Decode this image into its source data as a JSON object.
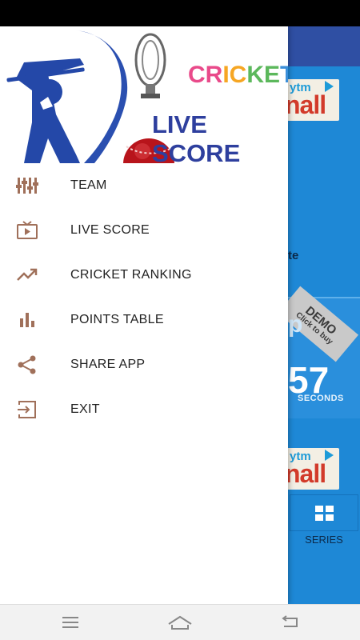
{
  "header": {
    "title_line1_parts": [
      "CR",
      "IC",
      "KE",
      "T"
    ],
    "title_line2": "LIVE SCORE"
  },
  "menu": {
    "items": [
      {
        "label": "TEAM",
        "icon": "equalizer-icon"
      },
      {
        "label": "LIVE SCORE",
        "icon": "tv-play-icon"
      },
      {
        "label": "CRICKET RANKING",
        "icon": "trending-up-icon"
      },
      {
        "label": "POINTS TABLE",
        "icon": "bar-chart-icon"
      },
      {
        "label": "SHARE APP",
        "icon": "share-icon"
      },
      {
        "label": "EXIT",
        "icon": "exit-icon"
      }
    ]
  },
  "background": {
    "ad_top": {
      "prefix": "ytm",
      "brand": "nall"
    },
    "ad_bottom": {
      "prefix": "ytm",
      "brand": "nall"
    },
    "partial_text": "te",
    "demo_ribbon": {
      "line1": "DEMO",
      "line2": "Click to buy"
    },
    "timer": {
      "value": "57",
      "unit": "SECONDS",
      "partial_left": "p"
    },
    "series_label": "SERIES"
  },
  "colors": {
    "accent_icon": "#a0705a",
    "background_app": "#1e88d6",
    "toolbar": "#2f4fa3",
    "title_blue": "#2e3f9e"
  }
}
